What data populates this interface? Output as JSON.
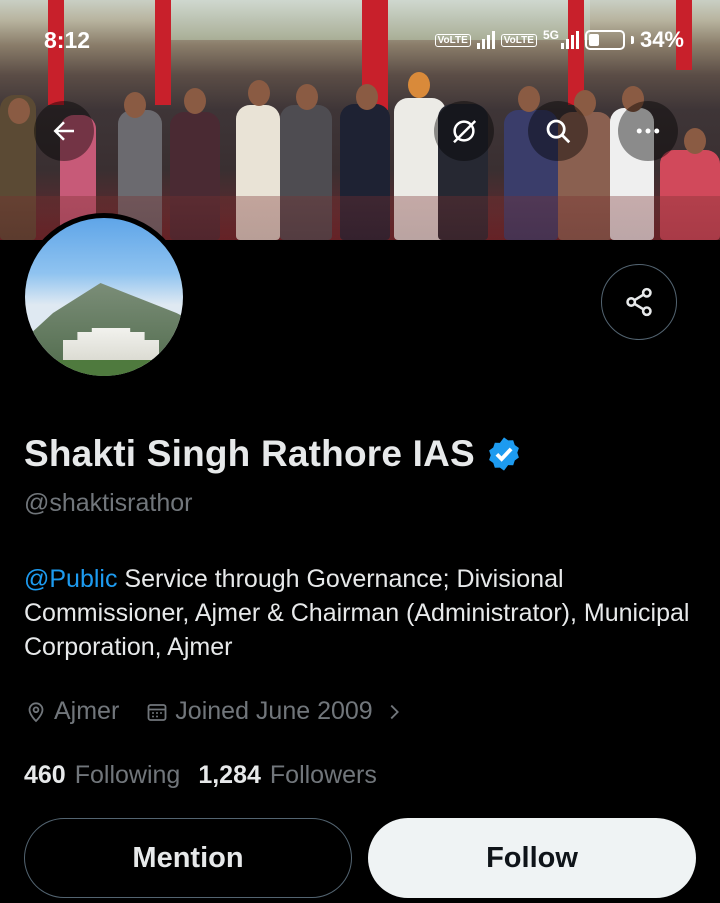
{
  "status_bar": {
    "time": "8:12",
    "network_1": "VoLTE",
    "network_2": "VoLTE",
    "network_type": "5G",
    "battery": "34%"
  },
  "header_buttons": {
    "back_icon": "arrow-left-icon",
    "grok_icon": "grok-icon",
    "search_icon": "search-icon",
    "more_icon": "more-dots-icon"
  },
  "profile": {
    "name": "Shakti Singh Rathore IAS",
    "verified": true,
    "handle": "@shaktisrathor",
    "bio_mention": "@Public",
    "bio_text": " Service through Governance; Divisional Commissioner, Ajmer & Chairman (Administrator), Municipal Corporation, Ajmer",
    "location": "Ajmer",
    "joined": "Joined June 2009",
    "following_count": "460",
    "following_label": "Following",
    "followers_count": "1,284",
    "followers_label": "Followers"
  },
  "actions": {
    "mention_label": "Mention",
    "follow_label": "Follow"
  },
  "colors": {
    "background": "#000000",
    "link": "#1d9bf0",
    "muted": "#71767b",
    "verified": "#1d9bf0"
  }
}
